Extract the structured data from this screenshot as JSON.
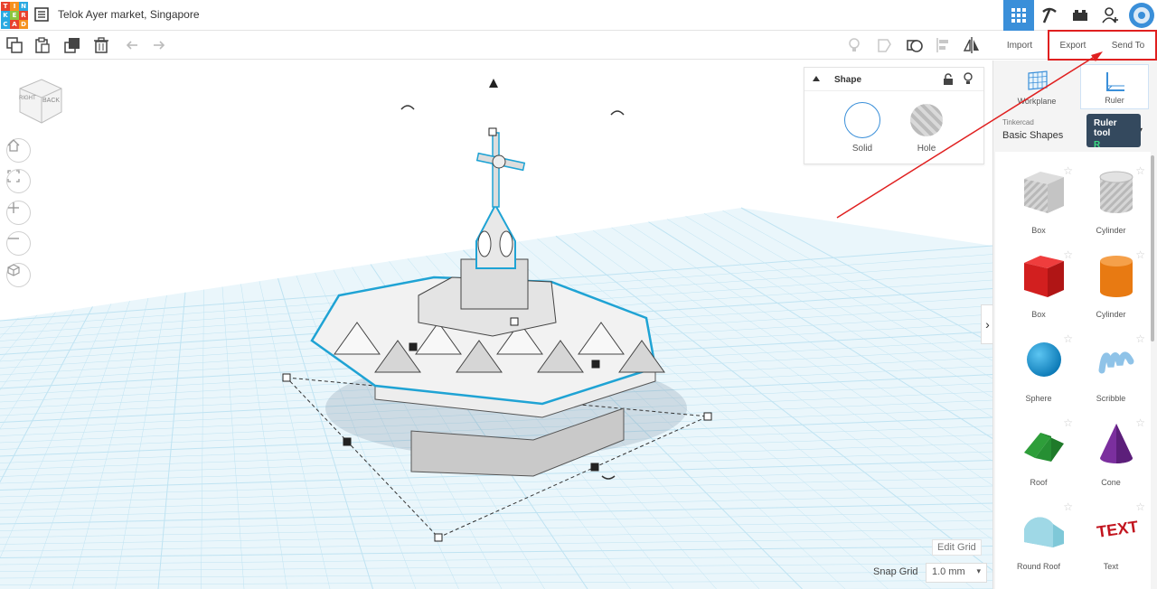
{
  "app": {
    "logo_letters": [
      "T",
      "I",
      "N",
      "K",
      "E",
      "R",
      "C",
      "A",
      "D"
    ],
    "design_title": "Telok Ayer market, Singapore"
  },
  "toolbar": {
    "import_label": "Import",
    "export_label": "Export",
    "send_to_label": "Send To"
  },
  "shape_panel": {
    "title": "Shape",
    "solid_label": "Solid",
    "hole_label": "Hole"
  },
  "viewcube": {
    "right_label": "RIGHT",
    "back_label": "BACK"
  },
  "workplane_controls": {
    "edit_grid_label": "Edit Grid",
    "snap_grid_label": "Snap Grid",
    "snap_grid_value": "1.0 mm"
  },
  "right_panel": {
    "workplane_label": "Workplane",
    "ruler_label": "Ruler",
    "library_small": "Tinkercad",
    "library_name": "Basic Shapes",
    "tooltip_title": "Ruler tool",
    "tooltip_key": "R",
    "shapes": [
      {
        "label": "Box"
      },
      {
        "label": "Cylinder"
      },
      {
        "label": "Box"
      },
      {
        "label": "Cylinder"
      },
      {
        "label": "Sphere"
      },
      {
        "label": "Scribble"
      },
      {
        "label": "Roof"
      },
      {
        "label": "Cone"
      },
      {
        "label": "Round Roof"
      },
      {
        "label": "Text"
      }
    ],
    "text_shape_glyph": "TEXT"
  },
  "colors": {
    "accent": "#3a8fd9",
    "grid_blue": "#bfe3f2",
    "selection_outline": "#1fa3d4",
    "callout_red": "#e02020"
  }
}
